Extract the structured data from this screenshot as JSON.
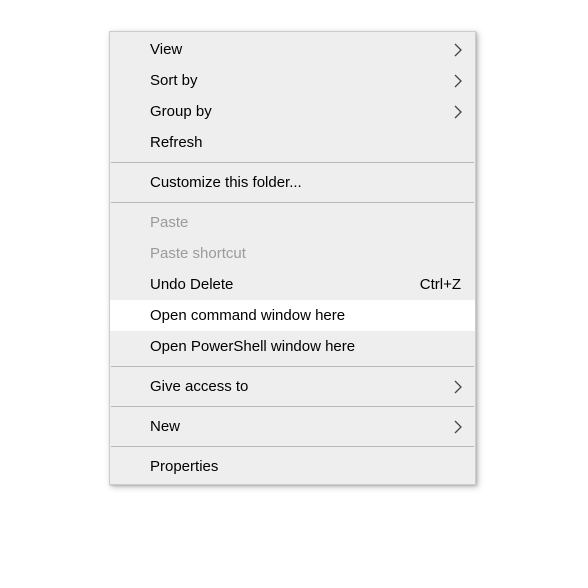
{
  "menu": {
    "items": [
      {
        "type": "item",
        "key": "view",
        "label": "View",
        "submenu": true
      },
      {
        "type": "item",
        "key": "sort-by",
        "label": "Sort by",
        "submenu": true
      },
      {
        "type": "item",
        "key": "group-by",
        "label": "Group by",
        "submenu": true
      },
      {
        "type": "item",
        "key": "refresh",
        "label": "Refresh"
      },
      {
        "type": "sep"
      },
      {
        "type": "item",
        "key": "customize",
        "label": "Customize this folder..."
      },
      {
        "type": "sep"
      },
      {
        "type": "item",
        "key": "paste",
        "label": "Paste",
        "disabled": true
      },
      {
        "type": "item",
        "key": "paste-shortcut",
        "label": "Paste shortcut",
        "disabled": true
      },
      {
        "type": "item",
        "key": "undo-delete",
        "label": "Undo Delete",
        "shortcut": "Ctrl+Z"
      },
      {
        "type": "item",
        "key": "open-cmd",
        "label": "Open command window here",
        "highlight": true
      },
      {
        "type": "item",
        "key": "open-powershell",
        "label": "Open PowerShell window here"
      },
      {
        "type": "sep"
      },
      {
        "type": "item",
        "key": "give-access",
        "label": "Give access to",
        "submenu": true
      },
      {
        "type": "sep"
      },
      {
        "type": "item",
        "key": "new",
        "label": "New",
        "submenu": true
      },
      {
        "type": "sep"
      },
      {
        "type": "item",
        "key": "properties",
        "label": "Properties"
      }
    ]
  }
}
